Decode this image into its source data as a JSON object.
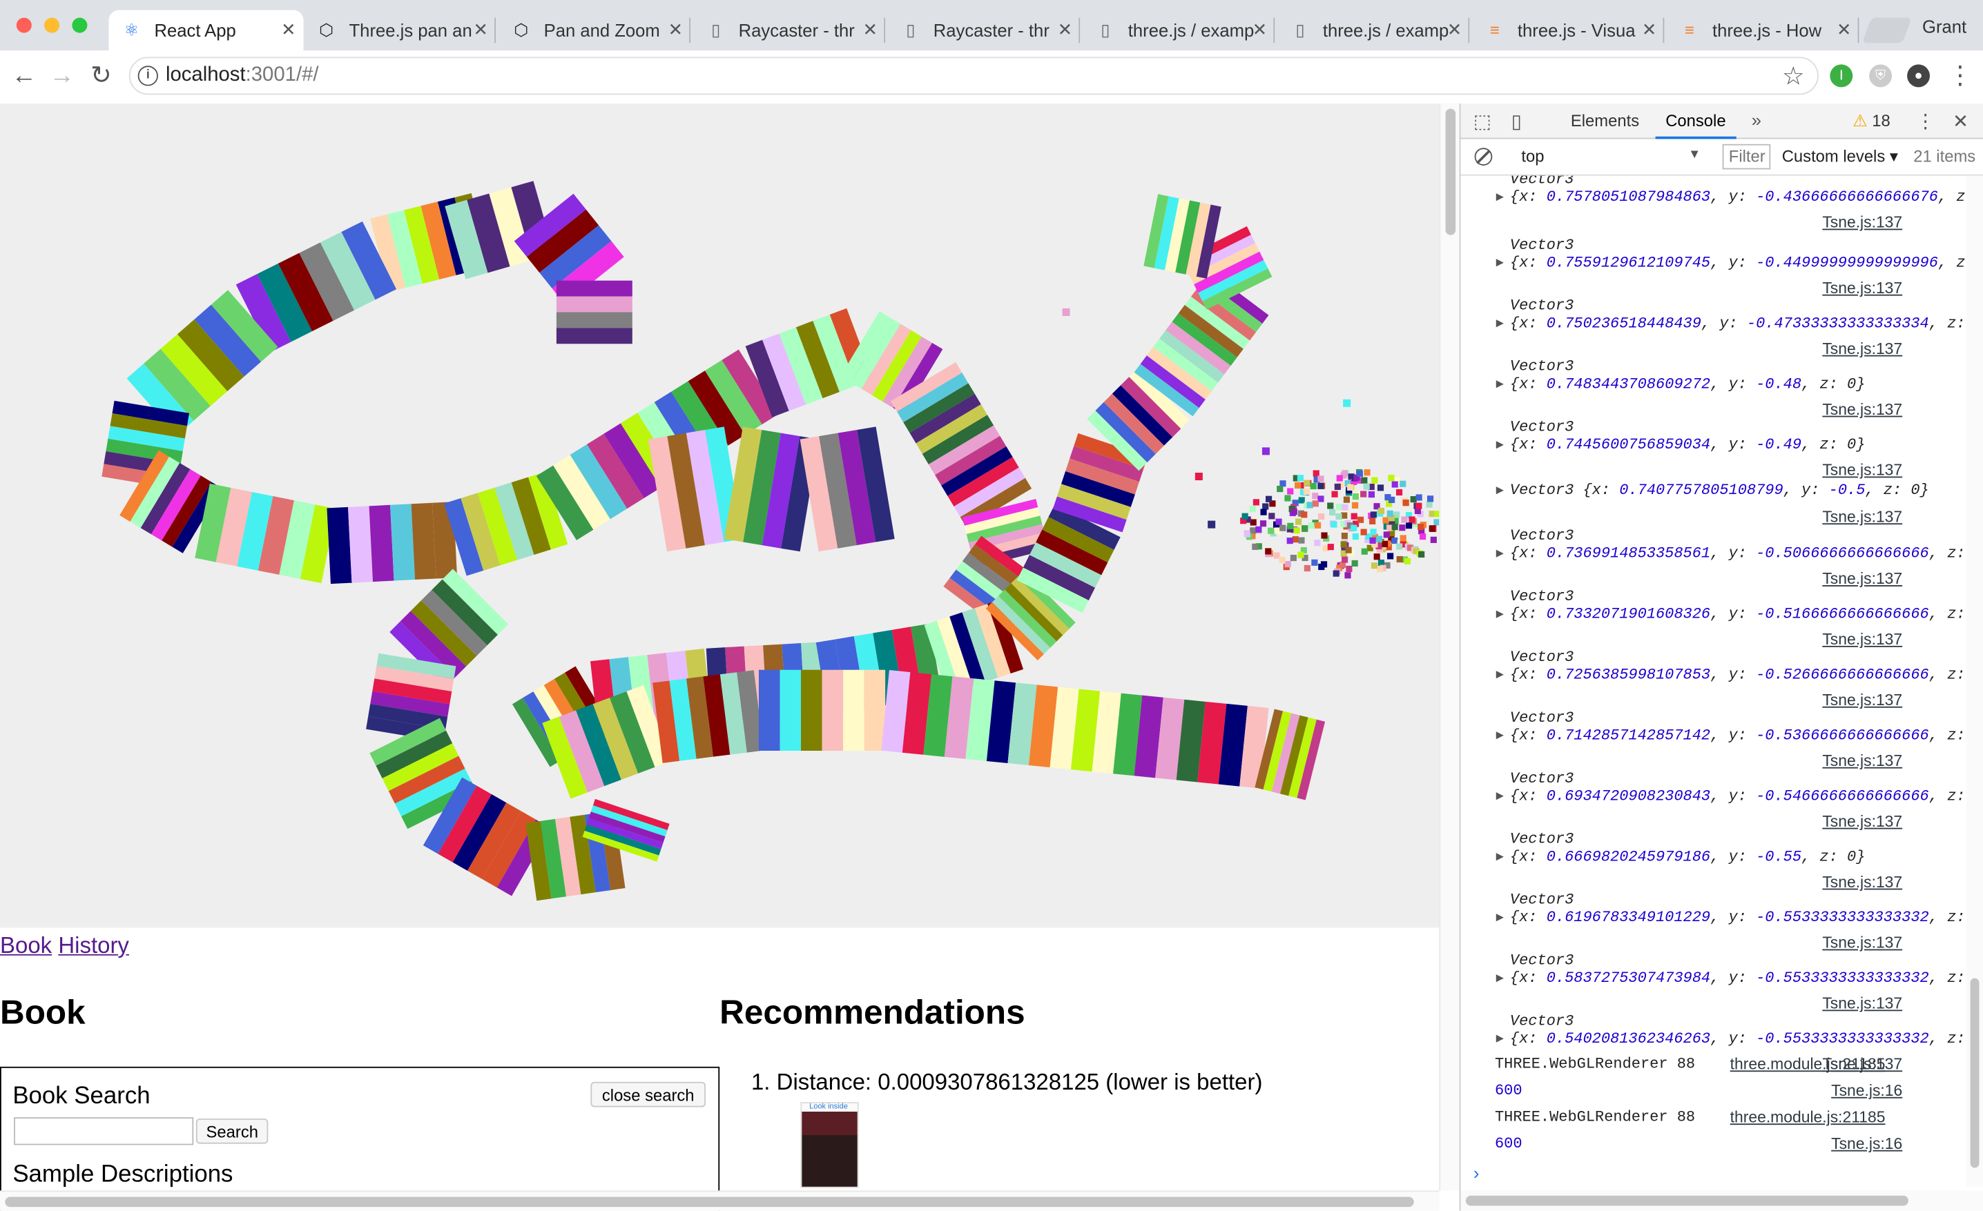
{
  "browser": {
    "tabs": [
      {
        "title": "React App",
        "icon": "react-icon",
        "active": true
      },
      {
        "title": "Three.js pan an",
        "icon": "codepen-icon"
      },
      {
        "title": "Pan and Zoom",
        "icon": "codepen-icon"
      },
      {
        "title": "Raycaster - thr",
        "icon": "page-icon"
      },
      {
        "title": "Raycaster - thr",
        "icon": "page-icon"
      },
      {
        "title": "three.js / examp",
        "icon": "page-icon"
      },
      {
        "title": "three.js / examp",
        "icon": "page-icon"
      },
      {
        "title": "three.js - Visua",
        "icon": "stackoverflow-icon"
      },
      {
        "title": "three.js - How",
        "icon": "stackoverflow-icon"
      }
    ],
    "profile": "Grant",
    "url_host": "localhost",
    "url_rest": ":3001/#/"
  },
  "page": {
    "nav_links": [
      "Book",
      "History"
    ],
    "book_heading": "Book",
    "recommendations_heading": "Recommendations",
    "search": {
      "title": "Book Search",
      "close_label": "close search",
      "input_value": "",
      "search_label": "Search",
      "samples_heading": "Sample Descriptions"
    },
    "recommendation": {
      "index": "1.",
      "text": "Distance: 0.0009307861328125 (lower is better)",
      "cover_badge": "Look inside"
    }
  },
  "devtools": {
    "tabs": [
      "Elements",
      "Console"
    ],
    "active_tab": "Console",
    "warning_count": "18",
    "context": "top",
    "filter_placeholder": "Filter",
    "levels": "Custom levels",
    "items_count": "21 items",
    "entries": [
      {
        "x": "0.7578051087984863",
        "y": "-0.43666666666666676",
        "tail": ", z",
        "src": "Tsne.js:137"
      },
      {
        "x": "0.7559129612109745",
        "y": "-0.44999999999999996",
        "tail": ", z",
        "src": "Tsne.js:137"
      },
      {
        "x": "0.750236518448439",
        "y": "-0.47333333333333334",
        "tail": ", z:",
        "src": "Tsne.js:137"
      },
      {
        "x": "0.7483443708609272",
        "y": "-0.48",
        "tail": ", z: 0}",
        "src": "Tsne.js:137"
      },
      {
        "x": "0.7445600756859034",
        "y": "-0.49",
        "tail": ", z: 0}",
        "src": "Tsne.js:137"
      },
      {
        "inline": true,
        "x": "0.7407757805108799",
        "y": "-0.5",
        "tail": ", z: 0}",
        "src": "Tsne.js:137"
      },
      {
        "x": "0.7369914853358561",
        "y": "-0.5066666666666666",
        "tail": ", z:",
        "src": "Tsne.js:137"
      },
      {
        "x": "0.7332071901608326",
        "y": "-0.5166666666666666",
        "tail": ", z:",
        "src": "Tsne.js:137"
      },
      {
        "x": "0.7256385998107853",
        "y": "-0.5266666666666666",
        "tail": ", z:",
        "src": "Tsne.js:137"
      },
      {
        "x": "0.7142857142857142",
        "y": "-0.5366666666666666",
        "tail": ", z:",
        "src": "Tsne.js:137"
      },
      {
        "x": "0.6934720908230843",
        "y": "-0.5466666666666666",
        "tail": ", z:",
        "src": "Tsne.js:137"
      },
      {
        "x": "0.6669820245979186",
        "y": "-0.55",
        "tail": ", z: 0}",
        "src": "Tsne.js:137"
      },
      {
        "x": "0.6196783349101229",
        "y": "-0.5533333333333332",
        "tail": ", z:",
        "src": "Tsne.js:137"
      },
      {
        "x": "0.5837275307473984",
        "y": "-0.5533333333333332",
        "tail": ", z:",
        "src": "Tsne.js:137"
      },
      {
        "x": "0.5402081362346263",
        "y": "-0.5533333333333332",
        "tail": ", z:",
        "src": "Tsne.js:137"
      }
    ],
    "logs": [
      {
        "text": "THREE.WebGLRenderer 88",
        "src": "three.module.js:21185",
        "kind": "text"
      },
      {
        "text": "600",
        "src": "Tsne.js:16",
        "kind": "number"
      },
      {
        "text": "THREE.WebGLRenderer 88",
        "src": "three.module.js:21185",
        "kind": "text"
      },
      {
        "text": "600",
        "src": "Tsne.js:16",
        "kind": "number"
      }
    ],
    "vector_label": "Vector3",
    "prompt": "›"
  }
}
